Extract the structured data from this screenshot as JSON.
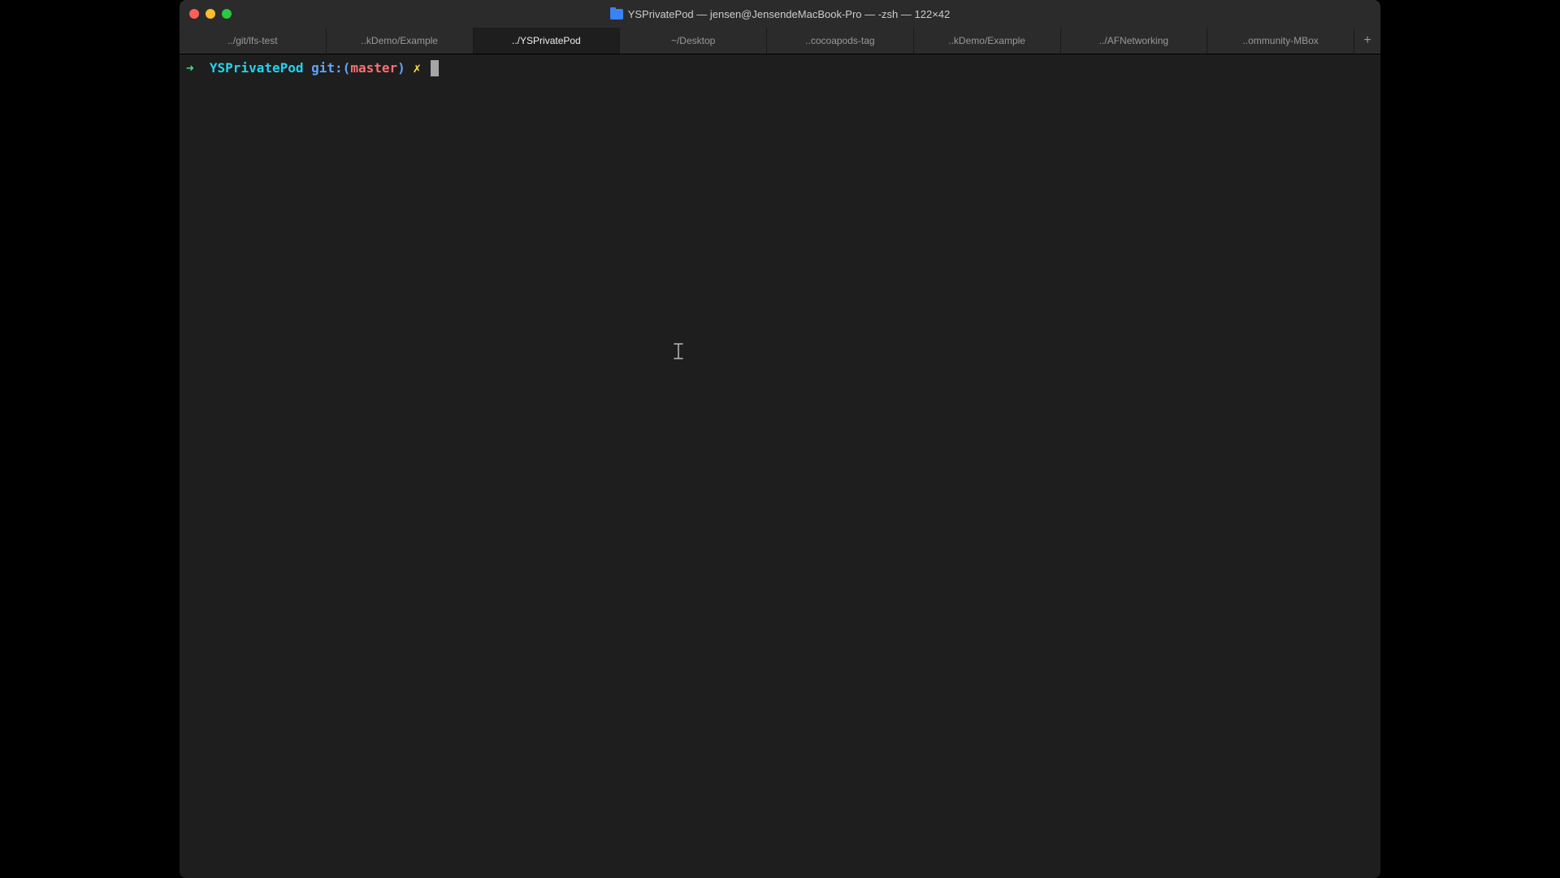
{
  "titlebar": {
    "title": "YSPrivatePod — jensen@JensendeMacBook-Pro — -zsh — 122×42"
  },
  "tabs": [
    {
      "label": "../git/lfs-test",
      "active": false
    },
    {
      "label": "..kDemo/Example",
      "active": false
    },
    {
      "label": "../YSPrivatePod",
      "active": true
    },
    {
      "label": "~/Desktop",
      "active": false
    },
    {
      "label": "..cocoapods-tag",
      "active": false
    },
    {
      "label": "..kDemo/Example",
      "active": false
    },
    {
      "label": "../AFNetworking",
      "active": false
    },
    {
      "label": "..ommunity-MBox",
      "active": false
    }
  ],
  "add_tab_label": "+",
  "prompt": {
    "arrow": "➜",
    "directory": "YSPrivatePod",
    "git_label": "git:",
    "paren_open": "(",
    "branch": "master",
    "paren_close": ")",
    "dirty_marker": "✗"
  }
}
